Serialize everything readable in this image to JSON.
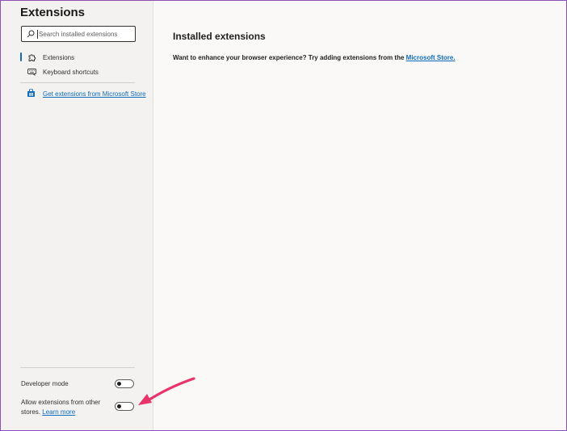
{
  "sidebar": {
    "title": "Extensions",
    "search": {
      "placeholder": "Search installed extensions",
      "value": ""
    },
    "nav": [
      {
        "label": "Extensions",
        "icon": "puzzle-icon",
        "selected": true
      },
      {
        "label": "Keyboard shortcuts",
        "icon": "keyboard-icon",
        "selected": false
      }
    ],
    "store_link": {
      "label": "Get extensions from Microsoft Store",
      "icon": "store-bag-icon"
    },
    "settings": {
      "developer_mode": {
        "label": "Developer mode",
        "on": false
      },
      "allow_other_stores": {
        "label": "Allow extensions from other stores.",
        "link": "Learn more",
        "on": false
      }
    }
  },
  "main": {
    "title": "Installed extensions",
    "description": "Want to enhance your browser experience? Try adding extensions from the",
    "description_link": "Microsoft Store.",
    "description_tail": ""
  },
  "annotation": {
    "icon": "pink-arrow-icon",
    "color": "#e8336b"
  },
  "colors": {
    "accent": "#0f6cbd",
    "sidebar_bg": "#f3f2f1",
    "main_bg": "#faf9f8",
    "frame": "#8e4fb5"
  }
}
